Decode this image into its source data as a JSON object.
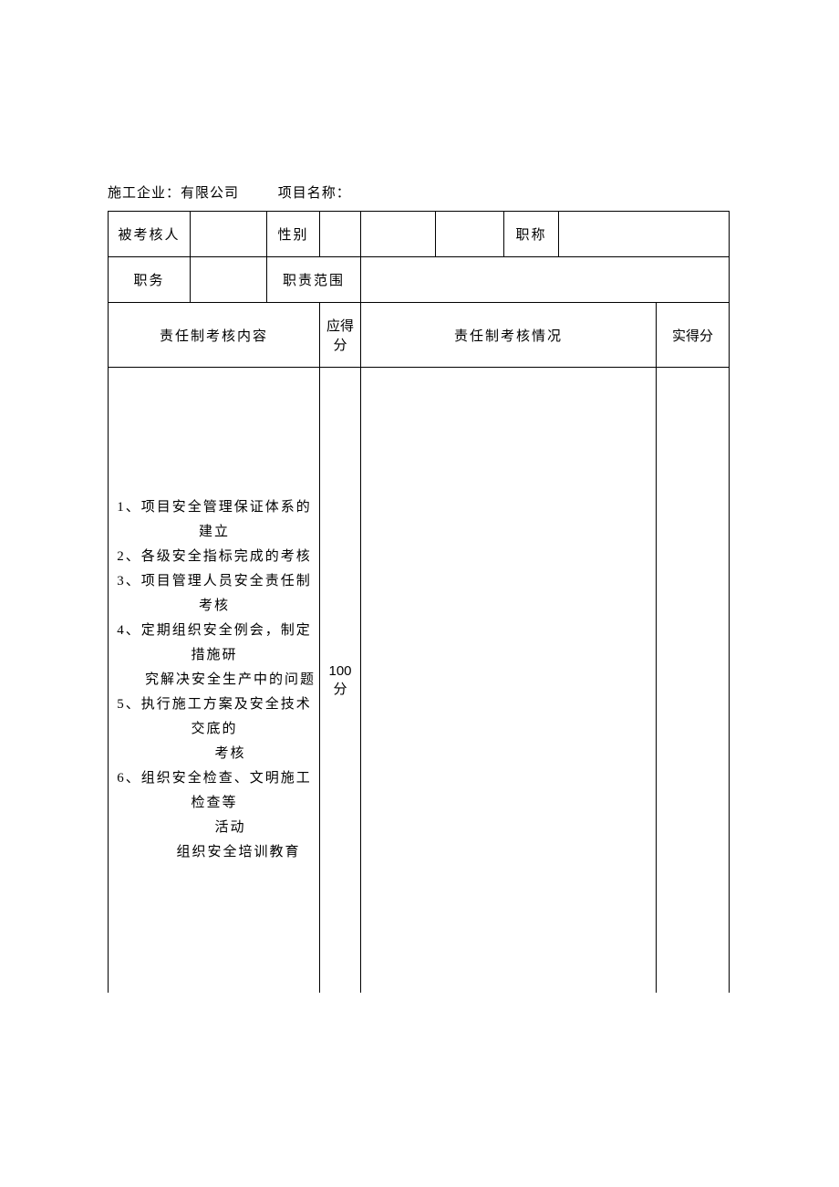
{
  "header": {
    "company_label": "施工企业：",
    "company_value": "有限公司",
    "project_label": "项目名称：",
    "project_value": ""
  },
  "row1": {
    "evaluee_label": "被考核人",
    "evaluee_value": "",
    "gender_label": "性别",
    "gender_value": "",
    "blank1": "",
    "blank2": "",
    "title_label": "职称",
    "title_value": ""
  },
  "row2": {
    "position_label": "职务",
    "position_value": "",
    "scope_label": "职责范围",
    "scope_value": ""
  },
  "row3": {
    "content_header": "责任制考核内容",
    "expected_score_header": "应得分",
    "status_header": "责任制考核情况",
    "actual_score_header": "实得分"
  },
  "content": {
    "item1": "1、项目安全管理保证体系的建立",
    "item2": "2、各级安全指标完成的考核",
    "item3": "3、项目管理人员安全责任制考核",
    "item4": "4、定期组织安全例会，制定措施研",
    "item4b": "究解决安全生产中的问题",
    "item5": "5、执行施工方案及安全技术交底的",
    "item5b": "考核",
    "item6": "6、组织安全检查、文明施工检查等",
    "item6b": "活动",
    "item7": "组织安全培训教育",
    "expected_score": "100 分",
    "status_value": "",
    "actual_score": ""
  }
}
